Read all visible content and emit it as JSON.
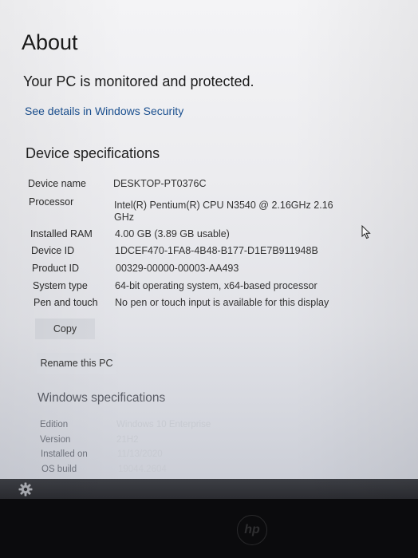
{
  "about": {
    "title": "About",
    "status": "Your PC is monitored and protected.",
    "security_link": "See details in Windows Security"
  },
  "device_specs": {
    "title": "Device specifications",
    "rows": [
      {
        "label": "Device name",
        "value": "DESKTOP-PT0376C"
      },
      {
        "label": "Processor",
        "value": "Intel(R) Pentium(R) CPU  N3540  @ 2.16GHz   2.16",
        "value2": "GHz"
      },
      {
        "label": "Installed RAM",
        "value": "4.00 GB (3.89 GB usable)"
      },
      {
        "label": "Device ID",
        "value": "1DCEF470-1FA8-4B48-B177-D1E7B911948B"
      },
      {
        "label": "Product ID",
        "value": "00329-00000-00003-AA493"
      },
      {
        "label": "System type",
        "value": "64-bit operating system, x64-based processor"
      },
      {
        "label": "Pen and touch",
        "value": "No pen or touch input is available for this display"
      }
    ],
    "copy_label": "Copy",
    "rename_label": "Rename this PC"
  },
  "windows_specs": {
    "title": "Windows specifications",
    "rows": [
      {
        "label": "Edition",
        "value": "Windows 10 Enterprise"
      },
      {
        "label": "Version",
        "value": "21H2"
      },
      {
        "label": "Installed on",
        "value": "11/13/2020"
      },
      {
        "label": "OS build",
        "value": "19044.2604"
      }
    ]
  },
  "icons": {
    "taskbar_settings": "gear-icon",
    "mouse_pointer": "cursor-icon",
    "laptop_brand": "hp-logo"
  },
  "brand": {
    "logo_text": "hp"
  },
  "colors": {
    "link": "#1a4f8f",
    "button": "#d6d8de",
    "taskbar": "#2b2c31"
  }
}
